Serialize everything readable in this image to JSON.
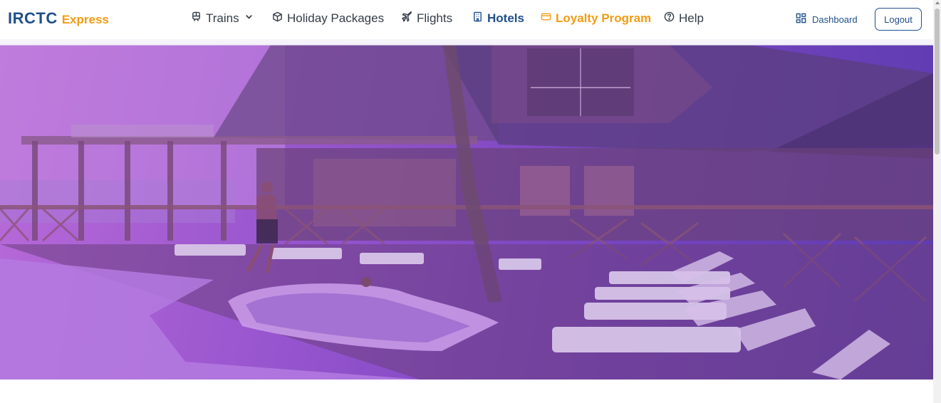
{
  "brand": {
    "main": "IRCTC",
    "sub": "Express"
  },
  "nav": {
    "trains": "Trains",
    "holiday": "Holiday Packages",
    "flights": "Flights",
    "hotels": "Hotels",
    "loyalty": "Loyalty Program",
    "help": "Help"
  },
  "account": {
    "dashboard": "Dashboard",
    "logout": "Logout"
  },
  "colors": {
    "primary": "#1f4f8c",
    "accent": "#f39c12",
    "hero_overlay": "#8a4fd0"
  }
}
